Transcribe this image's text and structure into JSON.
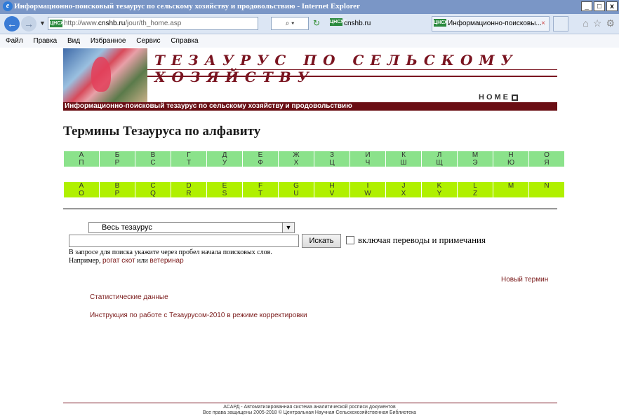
{
  "window": {
    "title": "Информационно-поисковый тезаурус по сельскому хозяйству и продовольствию - Internet Explorer",
    "controls": [
      "_",
      "□",
      "x"
    ]
  },
  "browser": {
    "address": "http://www.cnshb.ru/jour/th_home.asp",
    "address_prefix": "http://www.",
    "address_domain": "cnshb.ru",
    "address_path": "/jour/th_home.asp",
    "site_badge": "ЦНСХБ",
    "search_label": "⌕ ▾",
    "tab1_label": "cnshb.ru",
    "tab2_label": "Информационно-поисковы...",
    "tab2_close": "×"
  },
  "menu": [
    "Файл",
    "Правка",
    "Вид",
    "Избранное",
    "Сервис",
    "Справка"
  ],
  "banner": {
    "title": "ТЕЗАУРУС ПО СЕЛЬСКОМУ ХОЗЯЙСТВУ",
    "home_label": "HOME",
    "strip_text": "Информационно-поисковый тезаурус по сельскому хозяйству и продовольствию"
  },
  "page_title": "Термины Тезауруса по алфавиту",
  "alphabet_ru": [
    [
      "А",
      "Б",
      "В",
      "Г",
      "Д",
      "Е",
      "Ж",
      "З",
      "И",
      "К",
      "Л",
      "М",
      "Н",
      "О"
    ],
    [
      "П",
      "Р",
      "С",
      "Т",
      "У",
      "Ф",
      "Х",
      "Ц",
      "Ч",
      "Ш",
      "Щ",
      "Э",
      "Ю",
      "Я"
    ]
  ],
  "alphabet_lat": [
    [
      "A",
      "B",
      "C",
      "D",
      "E",
      "F",
      "G",
      "H",
      "I",
      "J",
      "K",
      "L",
      "M",
      "N"
    ],
    [
      "O",
      "P",
      "Q",
      "R",
      "S",
      "T",
      "U",
      "V",
      "W",
      "X",
      "Y",
      "Z",
      "",
      ""
    ]
  ],
  "search": {
    "scope_selected": "Весь тезаурус",
    "query_value": "",
    "button_label": "Искать",
    "checkbox_label": "включая переводы и примечания",
    "hint": "В запросе для поиска укажите через пробел начала поисковых слов.",
    "example_prefix": "Например, ",
    "example1": "рогат скот",
    "example_or": " или ",
    "example2": "ветеринар"
  },
  "links": {
    "new_term": "Новый термин",
    "stats": "Статистические данные",
    "instructions": "Инструкция по работе с Тезаурусом-2010 в режиме корректировки"
  },
  "footer": {
    "line1": "АСАРД - Автоматизированная система аналитической росписи документов",
    "line2": "Все права защищены 2005-2018 © Центральная Научная Сельскохозяйственная Библиотека"
  }
}
